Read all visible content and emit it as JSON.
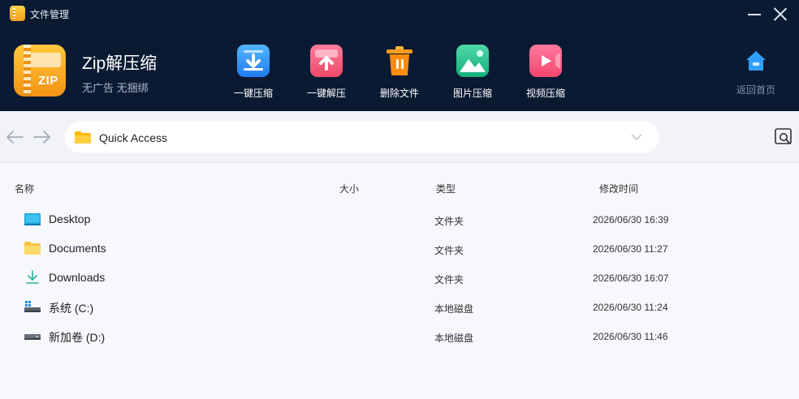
{
  "window": {
    "title": "文件管理"
  },
  "app": {
    "name": "Zip解压缩",
    "subtitle": "无广告 无捆绑",
    "logo_text": "ZIP"
  },
  "toolbar": [
    {
      "label": "一键压缩",
      "icon": "download-box-icon"
    },
    {
      "label": "一键解压",
      "icon": "upload-box-icon"
    },
    {
      "label": "删除文件",
      "icon": "trash-icon"
    },
    {
      "label": "图片压缩",
      "icon": "image-icon"
    },
    {
      "label": "视频压缩",
      "icon": "video-icon"
    }
  ],
  "home": {
    "label": "返回首页",
    "icon": "home-icon"
  },
  "address": {
    "path": "Quick Access"
  },
  "columns": {
    "name": "名称",
    "size": "大小",
    "type": "类型",
    "modified": "修改时间"
  },
  "files": [
    {
      "name": "Desktop",
      "size": "",
      "type": "文件夹",
      "modified": "2026/06/30 16:39",
      "icon": "desktop-icon"
    },
    {
      "name": "Documents",
      "size": "",
      "type": "文件夹",
      "modified": "2026/06/30 11:27",
      "icon": "folder-icon"
    },
    {
      "name": "Downloads",
      "size": "",
      "type": "文件夹",
      "modified": "2026/06/30 16:07",
      "icon": "download-icon"
    },
    {
      "name": "系统 (C:)",
      "size": "",
      "type": "本地磁盘",
      "modified": "2026/06/30 11:24",
      "icon": "system-drive-icon"
    },
    {
      "name": "新加卷 (D:)",
      "size": "",
      "type": "本地磁盘",
      "modified": "2026/06/30 11:46",
      "icon": "drive-icon"
    }
  ],
  "colors": {
    "header_bg": "#0b1a33",
    "accent": "#1f7ef0",
    "page_bg": "#f6f8fc"
  }
}
